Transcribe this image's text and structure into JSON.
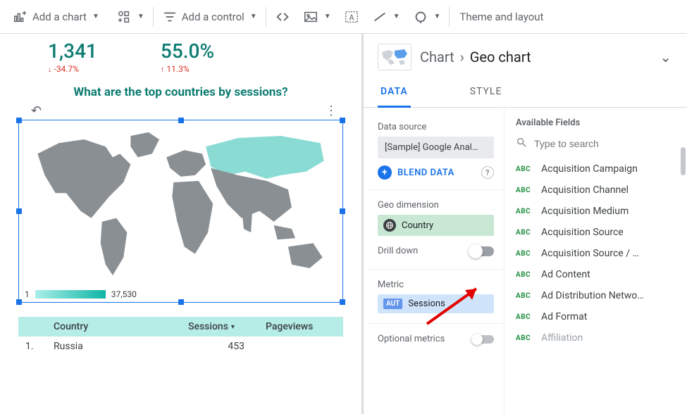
{
  "toolbar": {
    "add_chart": "Add a chart",
    "add_control": "Add a control",
    "theme": "Theme and layout"
  },
  "kpis": [
    {
      "value": "1,341",
      "delta": "-34.7%",
      "dir": "down"
    },
    {
      "value": "55.0%",
      "delta": "11.3%",
      "dir": "up"
    }
  ],
  "chart": {
    "title": "What are the top countries by sessions?",
    "legend_min": "1",
    "legend_max": "37,530",
    "table": {
      "headers": {
        "idx": "",
        "country": "Country",
        "sessions": "Sessions",
        "pageviews": "Pageviews"
      },
      "rows": [
        {
          "idx": "1.",
          "country": "Russia",
          "sessions": "453",
          "pageviews": ""
        }
      ]
    }
  },
  "breadcrumb": {
    "root": "Chart",
    "current": "Geo chart"
  },
  "tabs": {
    "data": "DATA",
    "style": "STYLE"
  },
  "ds_section": {
    "label": "Data source",
    "value": "[Sample] Google Anal…",
    "blend": "BLEND DATA"
  },
  "geo_dim": {
    "label": "Geo dimension",
    "value": "Country"
  },
  "drill": {
    "label": "Drill down"
  },
  "metric": {
    "label": "Metric",
    "value": "Sessions",
    "badge": "AUT"
  },
  "optional_metrics": {
    "label": "Optional metrics"
  },
  "fields": {
    "label": "Available Fields",
    "placeholder": "Type to search",
    "items": [
      "Acquisition Campaign",
      "Acquisition Channel",
      "Acquisition Medium",
      "Acquisition Source",
      "Acquisition Source / …",
      "Ad Content",
      "Ad Distribution Netwo…",
      "Ad Format",
      "Affiliation"
    ]
  },
  "chart_data": {
    "type": "table",
    "title": "What are the top countries by sessions?",
    "columns": [
      "Country",
      "Sessions",
      "Pageviews"
    ],
    "rows": [
      [
        "Russia",
        453,
        null
      ]
    ],
    "legend_range": [
      1,
      37530
    ]
  }
}
